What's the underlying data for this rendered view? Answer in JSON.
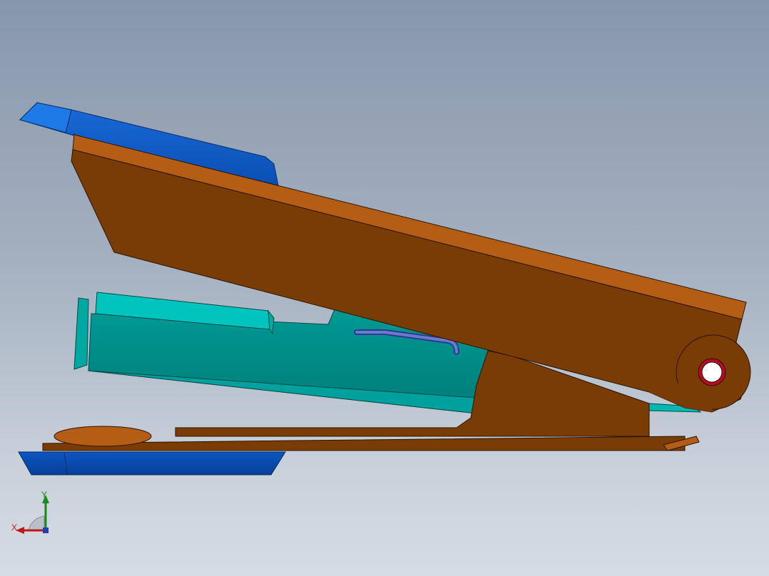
{
  "view": {
    "background_top": "#8797ab",
    "background_bottom": "#d6dce4"
  },
  "parts": {
    "handle_color": "#7a3c05",
    "handle_top_face_color": "#b35e14",
    "cap_color": "#0a58c8",
    "magazine_color": "#008a86",
    "magazine_top_color": "#00c2bc",
    "spring_color": "#4a5aa8",
    "pivot_ring_color": "#b01024"
  },
  "triad": {
    "x_label": "X",
    "y_label": "Y",
    "x_color": "#c01818",
    "y_color": "#1a8a1a"
  }
}
